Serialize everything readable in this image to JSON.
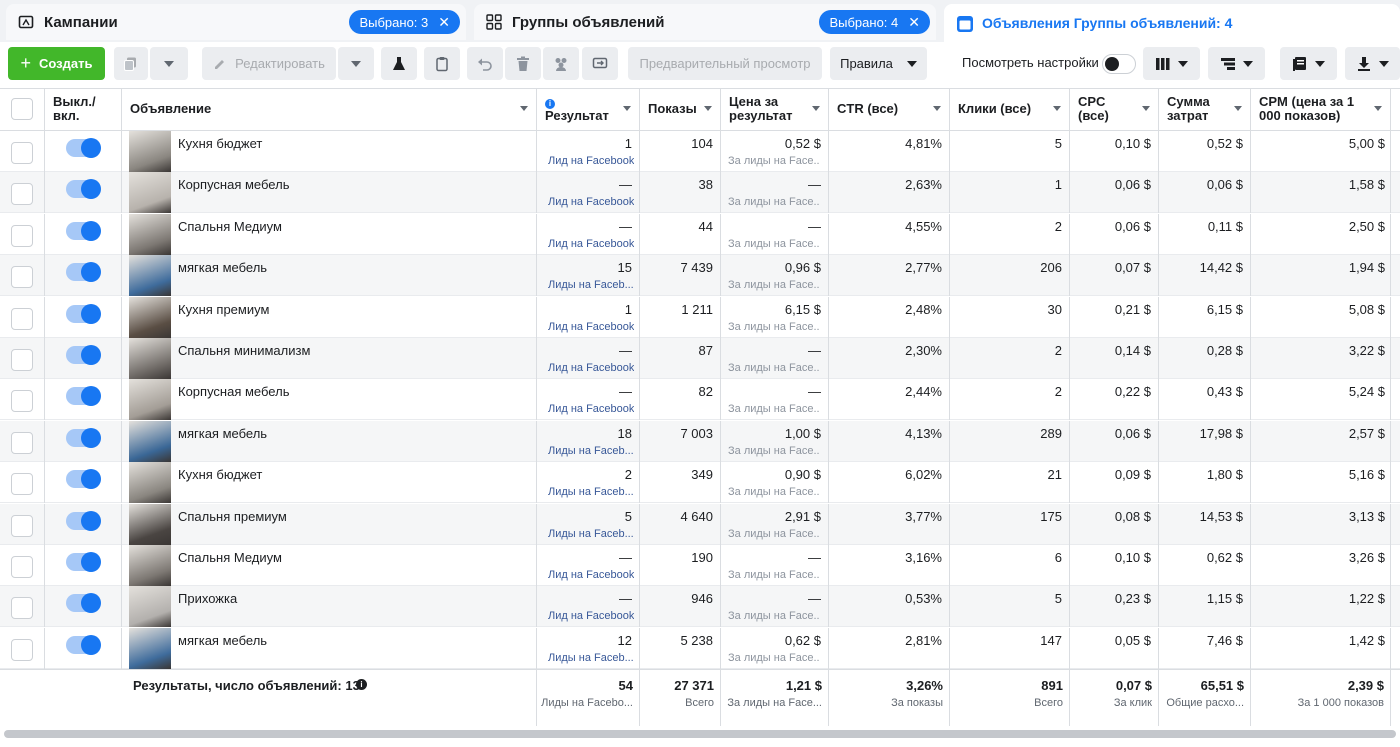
{
  "tabs": [
    {
      "label": "Кампании",
      "selected": "Выбрано: 3",
      "icon": "folder-icon"
    },
    {
      "label": "Группы объявлений",
      "selected": "Выбрано: 4",
      "icon": "grid-icon"
    },
    {
      "label": "Объявления Группы объявлений: 4",
      "icon": "ad-icon"
    }
  ],
  "toolbar": {
    "create_label": "Создать",
    "edit_label": "Редактировать",
    "preview_label": "Предварительный просмотр",
    "rules_label": "Правила",
    "view_settings_label": "Посмотреть настройки"
  },
  "columns": {
    "toggle": "Выкл./ вкл.",
    "ad": "Объявление",
    "result": "Результат",
    "impressions": "Показы",
    "cost_per_result": "Цена за результат",
    "ctr": "CTR (все)",
    "clicks": "Клики (все)",
    "cpc": "CPC (все)",
    "spend": "Сумма затрат",
    "cpm": "CPM (цена за 1 000 показов)"
  },
  "rows": [
    {
      "name": "Кухня бюджет",
      "result": "1",
      "result_sub": "Лид на Facebook",
      "impr": "104",
      "cpr": "0,52 $",
      "cpr_sub": "За лиды на Face...",
      "ctr": "4,81%",
      "clicks": "5",
      "cpc": "0,10 $",
      "spend": "0,52 $",
      "cpm": "5,00 $",
      "thumb": "#8a8680"
    },
    {
      "name": "Корпусная мебель",
      "result": "—",
      "result_sub": "Лид на Facebook",
      "impr": "38",
      "cpr": "—",
      "cpr_sub": "За лиды на Face...",
      "ctr": "2,63%",
      "clicks": "1",
      "cpc": "0,06 $",
      "spend": "0,06 $",
      "cpm": "1,58 $",
      "thumb": "#b7b2ac"
    },
    {
      "name": "Спальня Медиум",
      "result": "—",
      "result_sub": "Лид на Facebook",
      "impr": "44",
      "cpr": "—",
      "cpr_sub": "За лиды на Face...",
      "ctr": "4,55%",
      "clicks": "2",
      "cpc": "0,06 $",
      "spend": "0,11 $",
      "cpm": "2,50 $",
      "thumb": "#7d7873"
    },
    {
      "name": "мягкая мебель",
      "result": "15",
      "result_sub": "Лиды на Faceb...",
      "impr": "7 439",
      "cpr": "0,96 $",
      "cpr_sub": "За лиды на Face...",
      "ctr": "2,77%",
      "clicks": "206",
      "cpc": "0,07 $",
      "spend": "14,42 $",
      "cpm": "1,94 $",
      "thumb": "#3f6c9c"
    },
    {
      "name": "Кухня премиум",
      "result": "1",
      "result_sub": "Лид на Facebook",
      "impr": "1 211",
      "cpr": "6,15 $",
      "cpr_sub": "За лиды на Face...",
      "ctr": "2,48%",
      "clicks": "30",
      "cpc": "0,21 $",
      "spend": "6,15 $",
      "cpm": "5,08 $",
      "thumb": "#5a4e44"
    },
    {
      "name": "Спальня минимализм",
      "result": "—",
      "result_sub": "Лид на Facebook",
      "impr": "87",
      "cpr": "—",
      "cpr_sub": "За лиды на Face...",
      "ctr": "2,30%",
      "clicks": "2",
      "cpc": "0,14 $",
      "spend": "0,28 $",
      "cpm": "3,22 $",
      "thumb": "#6f6a66"
    },
    {
      "name": "Корпусная мебель",
      "result": "—",
      "result_sub": "Лид на Facebook",
      "impr": "82",
      "cpr": "—",
      "cpr_sub": "За лиды на Face...",
      "ctr": "2,44%",
      "clicks": "2",
      "cpc": "0,22 $",
      "spend": "0,43 $",
      "cpm": "5,24 $",
      "thumb": "#a39d96"
    },
    {
      "name": "мягкая мебель",
      "result": "18",
      "result_sub": "Лиды на Faceb...",
      "impr": "7 003",
      "cpr": "1,00 $",
      "cpr_sub": "За лиды на Face...",
      "ctr": "4,13%",
      "clicks": "289",
      "cpc": "0,06 $",
      "spend": "17,98 $",
      "cpm": "2,57 $",
      "thumb": "#3a6796"
    },
    {
      "name": "Кухня бюджет",
      "result": "2",
      "result_sub": "Лиды на Faceb...",
      "impr": "349",
      "cpr": "0,90 $",
      "cpr_sub": "За лиды на Face...",
      "ctr": "6,02%",
      "clicks": "21",
      "cpc": "0,09 $",
      "spend": "1,80 $",
      "cpm": "5,16 $",
      "thumb": "#8a8680"
    },
    {
      "name": "Спальня премиум",
      "result": "5",
      "result_sub": "Лиды на Faceb...",
      "impr": "4 640",
      "cpr": "2,91 $",
      "cpr_sub": "За лиды на Face...",
      "ctr": "3,77%",
      "clicks": "175",
      "cpc": "0,08 $",
      "spend": "14,53 $",
      "cpm": "3,13 $",
      "thumb": "#4a4542"
    },
    {
      "name": "Спальня Медиум",
      "result": "—",
      "result_sub": "Лид на Facebook",
      "impr": "190",
      "cpr": "—",
      "cpr_sub": "За лиды на Face...",
      "ctr": "3,16%",
      "clicks": "6",
      "cpc": "0,10 $",
      "spend": "0,62 $",
      "cpm": "3,26 $",
      "thumb": "#7d7873"
    },
    {
      "name": "Прихожка",
      "result": "—",
      "result_sub": "Лид на Facebook",
      "impr": "946",
      "cpr": "—",
      "cpr_sub": "За лиды на Face...",
      "ctr": "0,53%",
      "clicks": "5",
      "cpc": "0,23 $",
      "spend": "1,15 $",
      "cpm": "1,22 $",
      "thumb": "#b3b0ad"
    },
    {
      "name": "мягкая мебель",
      "result": "12",
      "result_sub": "Лиды на Faceb...",
      "impr": "5 238",
      "cpr": "0,62 $",
      "cpr_sub": "За лиды на Face...",
      "ctr": "2,81%",
      "clicks": "147",
      "cpc": "0,05 $",
      "spend": "7,46 $",
      "cpm": "1,42 $",
      "thumb": "#3f6c9c"
    }
  ],
  "footer": {
    "label": "Результаты, число объявлений: 13",
    "result": "54",
    "result_sub": "Лиды на Facebo...",
    "impr": "27 371",
    "impr_sub": "Всего",
    "cpr": "1,21 $",
    "cpr_sub": "За лиды на Face...",
    "ctr": "3,26%",
    "ctr_sub": "За показы",
    "clicks": "891",
    "clicks_sub": "Всего",
    "cpc": "0,07 $",
    "cpc_sub": "За клик",
    "spend": "65,51 $",
    "spend_sub": "Общие расхо...",
    "cpm": "2,39 $",
    "cpm_sub": "За 1 000 показов"
  },
  "colors": {
    "accent": "#1877f2",
    "create_green": "#42b72a"
  }
}
